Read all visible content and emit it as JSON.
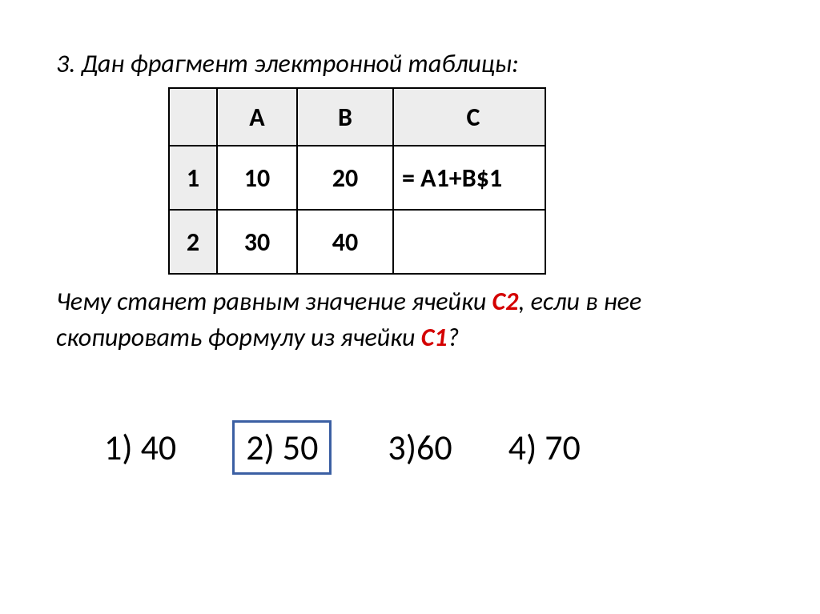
{
  "question": {
    "intro": "3. Дан фрагмент электронной таблицы:",
    "tail_before_c2": "Чему станет равным значение ячейки ",
    "c2": "С2",
    "tail_mid": ", если в нее скопировать формулу из ячейки ",
    "c1": "С1",
    "tail_end": "?"
  },
  "table": {
    "headers": {
      "blank": "",
      "a": "A",
      "b": "B",
      "c": "C"
    },
    "rows": [
      {
        "label": "1",
        "a": "10",
        "b": "20",
        "c": "= A1+B$1"
      },
      {
        "label": "2",
        "a": "30",
        "b": "40",
        "c": ""
      }
    ]
  },
  "answers": {
    "opt1": "1) 40",
    "opt2": "2) 50",
    "opt3": "3)60",
    "opt4": "4) 70",
    "correct_index": 1
  },
  "chart_data": {
    "type": "table",
    "headers": [
      "",
      "A",
      "B",
      "C"
    ],
    "rows": [
      [
        "1",
        "10",
        "20",
        "= A1+B$1"
      ],
      [
        "2",
        "30",
        "40",
        ""
      ]
    ]
  }
}
